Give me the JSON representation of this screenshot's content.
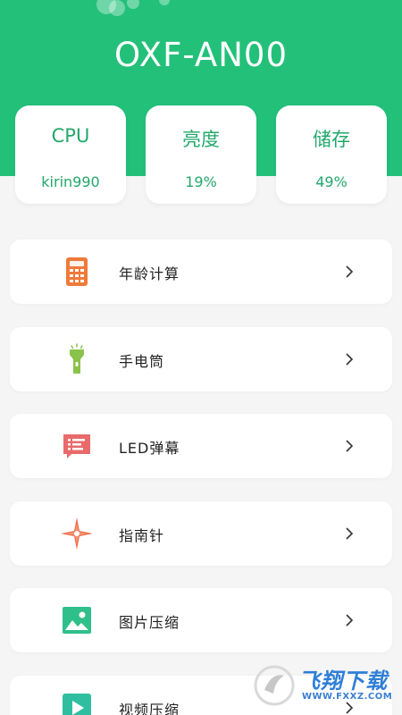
{
  "header": {
    "device_name": "OXF-AN00",
    "background_color": "#23c07a"
  },
  "stats": [
    {
      "label": "CPU",
      "value": "kirin990"
    },
    {
      "label": "亮度",
      "value": "19%"
    },
    {
      "label": "储存",
      "value": "49%"
    }
  ],
  "menu": [
    {
      "label": "年龄计算",
      "icon": "calculator-icon",
      "color": "#f07a3a"
    },
    {
      "label": "手电筒",
      "icon": "flashlight-icon",
      "color": "#8bc34a"
    },
    {
      "label": "LED弹幕",
      "icon": "led-message-icon",
      "color": "#e86a6a"
    },
    {
      "label": "指南针",
      "icon": "compass-icon",
      "color": "#ef6c4a"
    },
    {
      "label": "图片压缩",
      "icon": "image-icon",
      "color": "#2fbf8a"
    },
    {
      "label": "视频压缩",
      "icon": "video-play-icon",
      "color": "#2fbfa0"
    }
  ],
  "watermark": {
    "text": "飞翔下载",
    "url": "WWW.FXXZ.COM"
  }
}
